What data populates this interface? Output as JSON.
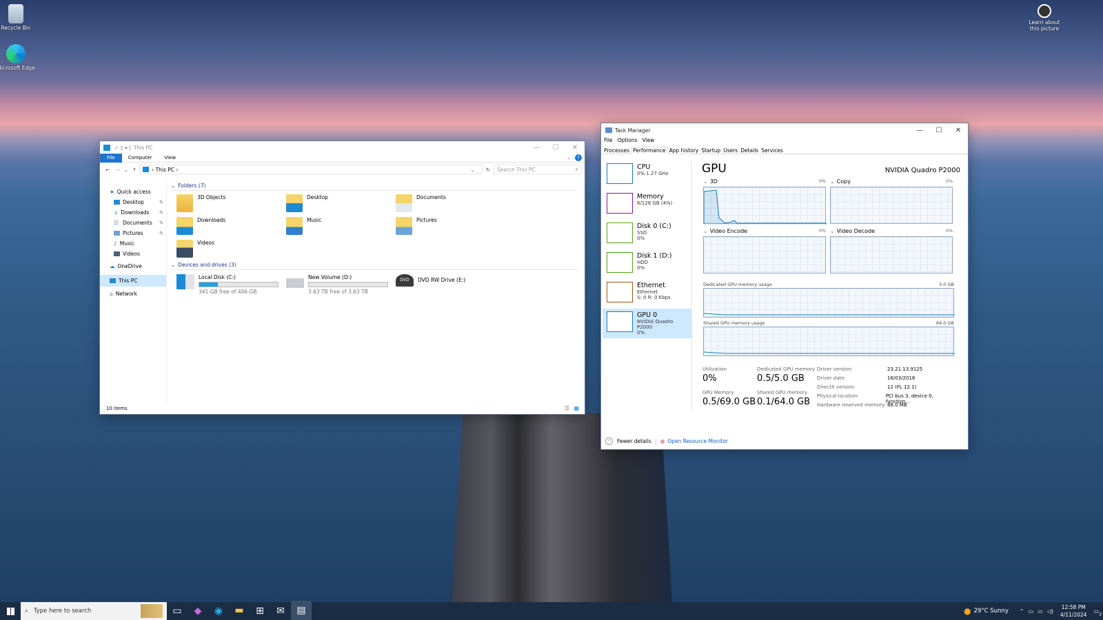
{
  "desktop": {
    "icons": [
      {
        "label": "Recycle Bin",
        "icon": "recycle-bin-icon"
      },
      {
        "label": "Microsoft Edge",
        "icon": "edge-icon"
      }
    ],
    "learn_label": "Learn about this picture"
  },
  "explorer": {
    "title": "This PC",
    "ribbon_tabs": [
      "File",
      "Computer",
      "View"
    ],
    "address": "This PC",
    "search_placeholder": "Search This PC",
    "nav": {
      "quick_access": "Quick access",
      "items": [
        "Desktop",
        "Downloads",
        "Documents",
        "Pictures",
        "Music",
        "Videos"
      ],
      "onedrive": "OneDrive",
      "this_pc": "This PC",
      "network": "Network"
    },
    "folders_header": "Folders (7)",
    "folders": [
      "3D Objects",
      "Desktop",
      "Documents",
      "Downloads",
      "Music",
      "Pictures",
      "Videos"
    ],
    "drives_header": "Devices and drives (3)",
    "drives": [
      {
        "name": "Local Disk (C:)",
        "free": "341 GB free of 446 GB",
        "used_fraction": 0.24
      },
      {
        "name": "New Volume (D:)",
        "free": "3.63 TB free of 3.63 TB",
        "used_fraction": 0.0
      },
      {
        "name": "DVD RW Drive (E:)"
      }
    ],
    "status": "10 items"
  },
  "taskmgr": {
    "title": "Task Manager",
    "menu": [
      "File",
      "Options",
      "View"
    ],
    "tabs": [
      "Processes",
      "Performance",
      "App history",
      "Startup",
      "Users",
      "Details",
      "Services"
    ],
    "side": [
      {
        "name": "CPU",
        "l1": "0% 1.27 GHz",
        "l2": "",
        "color": "#117dbb"
      },
      {
        "name": "Memory",
        "l1": "6/128 GB (4%)",
        "l2": "",
        "color": "#8b12ae"
      },
      {
        "name": "Disk 0 (C:)",
        "l1": "SSD",
        "l2": "0%",
        "color": "#4da60c"
      },
      {
        "name": "Disk 1 (D:)",
        "l1": "HDD",
        "l2": "0%",
        "color": "#4da60c"
      },
      {
        "name": "Ethernet",
        "l1": "Ethernet",
        "l2": "S: 0 R: 0 Kbps",
        "color": "#a74f01"
      },
      {
        "name": "GPU 0",
        "l1": "NVIDIA Quadro P2000",
        "l2": "0%",
        "color": "#117dbb"
      }
    ],
    "gpu_title": "GPU",
    "gpu_model": "NVIDIA Quadro P2000",
    "graphs": [
      {
        "name": "3D",
        "pct": "0%"
      },
      {
        "name": "Copy",
        "pct": "0%"
      },
      {
        "name": "Video Encode",
        "pct": "0%"
      },
      {
        "name": "Video Decode",
        "pct": "0%"
      }
    ],
    "dedicated_label": "Dedicated GPU memory usage",
    "dedicated_max": "5.0 GB",
    "shared_label": "Shared GPU memory usage",
    "shared_max": "64.0 GB",
    "stats": {
      "util_label": "Utilization",
      "util": "0%",
      "ded_label": "Dedicated GPU memory",
      "ded": "0.5/5.0 GB",
      "gpumem_label": "GPU Memory",
      "gpumem": "0.5/69.0 GB",
      "shared_label": "Shared GPU memory",
      "shared": "0.1/64.0 GB"
    },
    "info": [
      [
        "Driver version:",
        "23.21.13.9125"
      ],
      [
        "Driver date:",
        "16/03/2018"
      ],
      [
        "DirectX version:",
        "12 (FL 12.1)"
      ],
      [
        "Physical location:",
        "PCI bus 3, device 0, function..."
      ],
      [
        "Hardware reserved memory:",
        "88.0 MB"
      ]
    ],
    "fewer": "Fewer details",
    "resmon": "Open Resource Monitor"
  },
  "taskbar": {
    "search_placeholder": "Type here to search",
    "weather": "29°C Sunny",
    "time": "12:58 PM",
    "date": "4/11/2024",
    "notif": "3"
  }
}
